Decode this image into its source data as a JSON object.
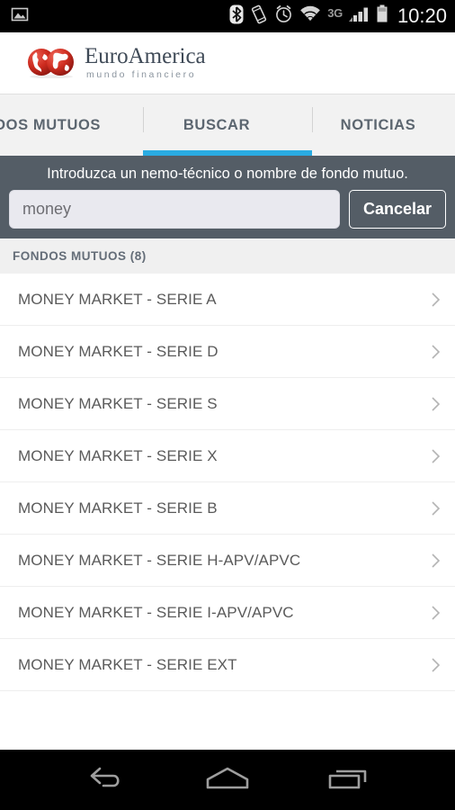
{
  "statusbar": {
    "icons": [
      "image-icon",
      "bluetooth-icon",
      "vibrate-icon",
      "alarm-icon",
      "wifi-icon",
      "signal-icon",
      "battery-icon"
    ],
    "network": "3G",
    "time": "10:20"
  },
  "brand": {
    "logo_icon": "euroamerica-globes-logo",
    "name": "EuroAmerica",
    "tagline": "mundo financiero",
    "name_color": "#3f4a57",
    "tagline_color": "#8a949e",
    "globe_color": "#c9271f"
  },
  "tabs": {
    "items": [
      {
        "label": "FONDOS MUTUOS",
        "active": false
      },
      {
        "label": "BUSCAR",
        "active": true
      },
      {
        "label": "NOTICIAS",
        "active": false
      }
    ],
    "active_index": 1,
    "accent_color": "#29abe2"
  },
  "search": {
    "hint": "Introduzca un nemo-técnico o nombre de fondo mutuo.",
    "value": "money",
    "placeholder": "",
    "cancel_label": "Cancelar",
    "band_color": "#545d66"
  },
  "results": {
    "section_title": "FONDOS MUTUOS (8)",
    "count": 8,
    "items": [
      {
        "label": "MONEY MARKET - SERIE A"
      },
      {
        "label": "MONEY MARKET - SERIE D"
      },
      {
        "label": "MONEY MARKET - SERIE S"
      },
      {
        "label": "MONEY MARKET - SERIE X"
      },
      {
        "label": "MONEY MARKET - SERIE B"
      },
      {
        "label": "MONEY MARKET - SERIE H-APV/APVC"
      },
      {
        "label": "MONEY MARKET - SERIE I-APV/APVC"
      },
      {
        "label": "MONEY MARKET - SERIE EXT"
      }
    ],
    "chevron_icon": "chevron-right-icon"
  },
  "navbar": {
    "buttons": [
      {
        "icon": "back-icon"
      },
      {
        "icon": "home-icon"
      },
      {
        "icon": "recents-icon"
      }
    ]
  }
}
